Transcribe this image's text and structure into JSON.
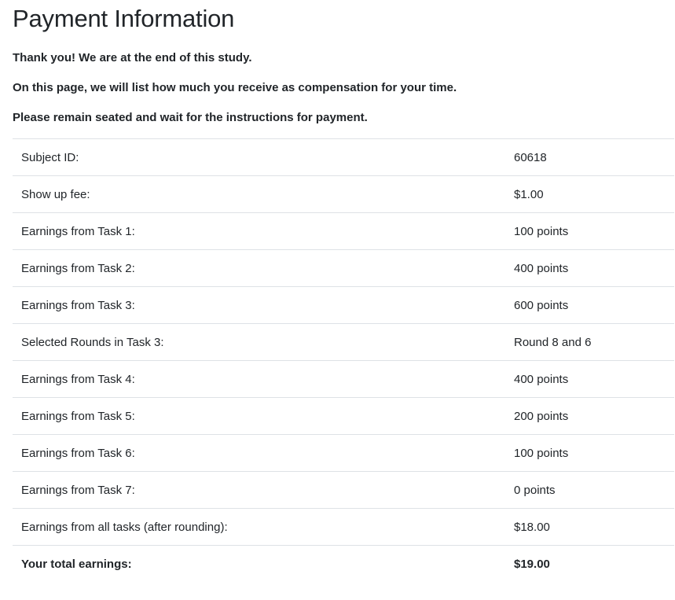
{
  "page": {
    "title": "Payment Information",
    "paragraphs": [
      "Thank you! We are at the end of this study.",
      "On this page, we will list how much you receive as compensation for your time.",
      "Please remain seated and wait for the instructions for payment."
    ]
  },
  "table": {
    "rows": [
      {
        "label": "Subject ID:",
        "value": "60618"
      },
      {
        "label": "Show up fee:",
        "value": "$1.00"
      },
      {
        "label": "Earnings from Task 1:",
        "value": "100 points"
      },
      {
        "label": "Earnings from Task 2:",
        "value": "400 points"
      },
      {
        "label": "Earnings from Task 3:",
        "value": "600 points"
      },
      {
        "label": "Selected Rounds in Task 3:",
        "value": "Round 8 and 6"
      },
      {
        "label": "Earnings from Task 4:",
        "value": "400 points"
      },
      {
        "label": "Earnings from Task 5:",
        "value": "200 points"
      },
      {
        "label": "Earnings from Task 6:",
        "value": "100 points"
      },
      {
        "label": "Earnings from Task 7:",
        "value": "0 points"
      },
      {
        "label": "Earnings from all tasks (after rounding):",
        "value": "$18.00"
      }
    ],
    "total": {
      "label": "Your total earnings:",
      "value": "$19.00"
    }
  }
}
